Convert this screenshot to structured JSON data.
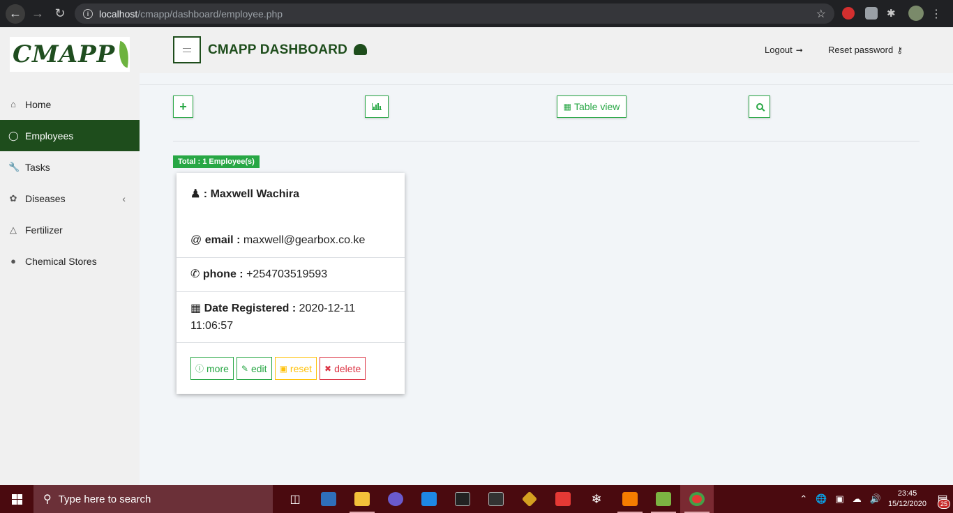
{
  "browser": {
    "url_host": "localhost",
    "url_path": "/cmapp/dashboard/employee.php"
  },
  "logo": {
    "text": "CMAPP"
  },
  "sidebar": {
    "items": [
      {
        "label": "Home",
        "icon": "home-icon"
      },
      {
        "label": "Employees",
        "icon": "user-icon",
        "active": true
      },
      {
        "label": "Tasks",
        "icon": "wrench-icon"
      },
      {
        "label": "Diseases",
        "icon": "leaf-icon",
        "has_submenu": true
      },
      {
        "label": "Fertilizer",
        "icon": "flask-icon"
      },
      {
        "label": "Chemical Stores",
        "icon": "map-marker-icon"
      }
    ]
  },
  "header": {
    "title": "CMAPP DASHBOARD",
    "logout_label": "Logout",
    "reset_password_label": "Reset password"
  },
  "toolbar": {
    "add_icon": "+",
    "table_view_label": "Table view"
  },
  "summary": {
    "total_label": "Total : 1 Employee(s)"
  },
  "employee": {
    "name_prefix": ":",
    "name": "Maxwell Wachira",
    "email_prefix": "@",
    "email_label": "email :",
    "email": "maxwell@gearbox.co.ke",
    "phone_label": "phone :",
    "phone": "+254703519593",
    "date_label": "Date Registered :",
    "date": "2020-12-11 11:06:57",
    "actions": {
      "more": "more",
      "edit": "edit",
      "reset": "reset",
      "delete": "delete"
    }
  },
  "colors": {
    "primary_green": "#1e4d1c",
    "success": "#28a745",
    "warning": "#ffc107",
    "danger": "#dc3545"
  },
  "taskbar": {
    "search_placeholder": "Type here to search",
    "time": "23:45",
    "date": "15/12/2020",
    "notifications": "25"
  }
}
